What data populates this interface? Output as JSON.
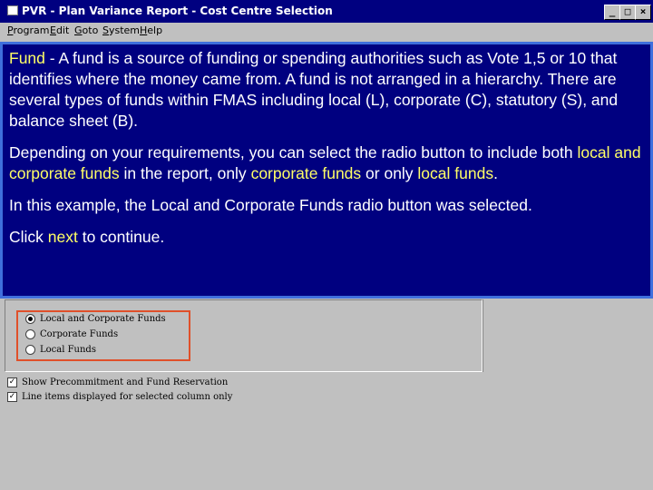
{
  "window": {
    "title": "PVR - Plan Variance Report - Cost Centre Selection",
    "minimize": "_",
    "maximize": "□",
    "close": "×"
  },
  "menu": {
    "items": [
      {
        "label": "Program",
        "u": "P",
        "rest": "rogram"
      },
      {
        "label": "Edit",
        "u": "E",
        "rest": "dit"
      },
      {
        "label": "Goto",
        "u": "G",
        "rest": "oto"
      },
      {
        "label": "System",
        "u": "S",
        "rest": "ystem"
      },
      {
        "label": "Help",
        "u": "H",
        "rest": "elp"
      }
    ]
  },
  "overlay": {
    "p1_term": "Fund",
    "p1_text": " - A fund is a source of funding or spending authorities such as Vote 1,5 or 10 that identifies where the money came from. A fund is not arranged in a hierarchy. There are several types of funds within FMAS including local (L), corporate (C), statutory (S), and balance sheet (B).",
    "p2_a": "Depending on your requirements, you can select the radio button to include both ",
    "p2_hl1": "local and corporate funds",
    "p2_b": " in the report, only ",
    "p2_hl2": "corporate funds",
    "p2_c": " or only ",
    "p2_hl3": "local funds",
    "p2_d": ".",
    "p3": "In this example, the Local and Corporate Funds radio button was selected.",
    "p4_a": "Click ",
    "p4_hl": "next",
    "p4_b": " to continue."
  },
  "funds": {
    "options": [
      {
        "label": "Local and Corporate Funds",
        "selected": true
      },
      {
        "label": "Corporate Funds",
        "selected": false
      },
      {
        "label": "Local Funds",
        "selected": false
      }
    ]
  },
  "checkboxes": [
    {
      "label": "Show Precommitment and Fund Reservation",
      "checked": true,
      "mark": "✓"
    },
    {
      "label": "Line items displayed for selected column only",
      "checked": true,
      "mark": "✓"
    }
  ]
}
